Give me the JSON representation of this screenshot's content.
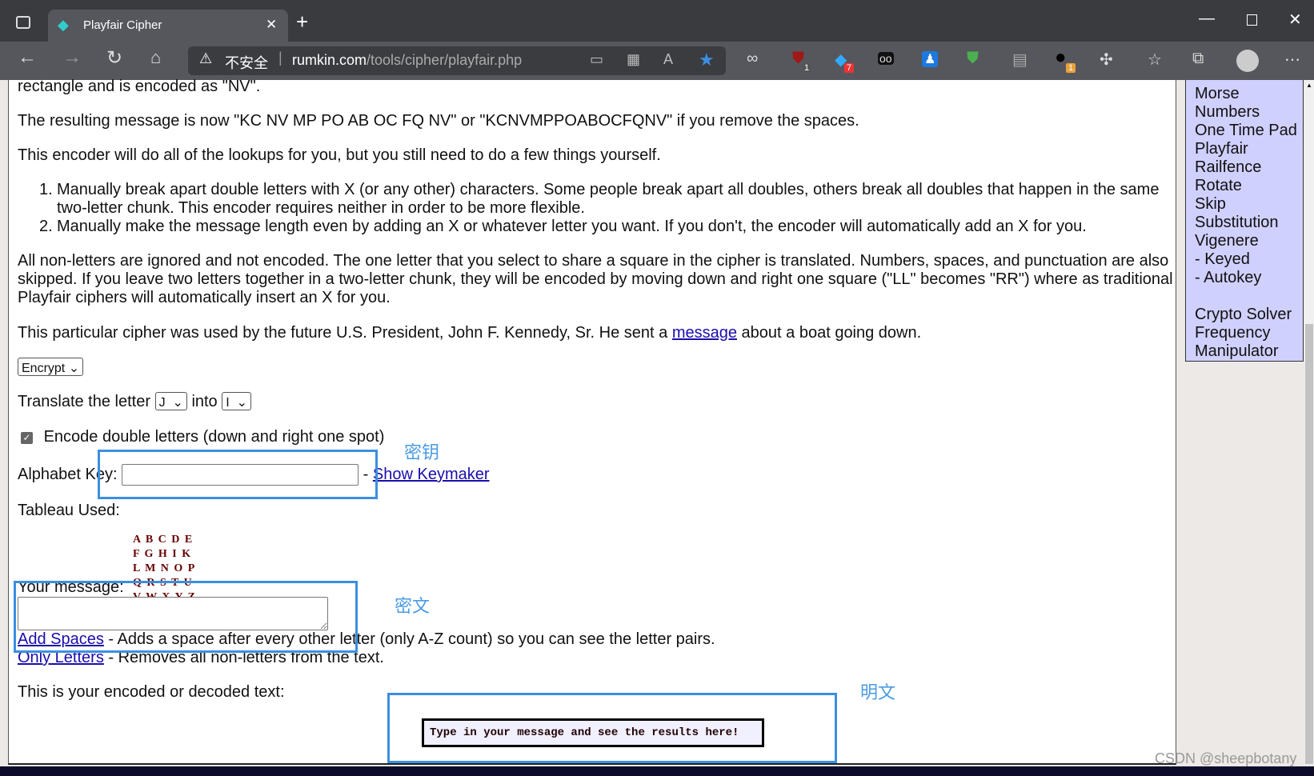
{
  "browser": {
    "tab_title": "Playfair Cipher",
    "security_label": "不安全",
    "url_domain": "rumkin.com",
    "url_path": "/tools/cipher/playfair.php",
    "extension_badges": {
      "ublock": "1",
      "ext2": "7",
      "ext_last": "1"
    }
  },
  "content": {
    "p0": "rectangle and is encoded as \"NV\".",
    "p1": "The resulting message is now \"KC NV MP PO AB OC FQ NV\" or \"KCNVMPPOABOCFQNV\" if you remove the spaces.",
    "p2": "This encoder will do all of the lookups for you, but you still need to do a few things yourself.",
    "list": [
      "Manually break apart double letters with X (or any other) characters. Some people break apart all doubles, others break all doubles that happen in the same two-letter chunk. This encoder requires neither in order to be more flexible.",
      "Manually make the message length even by adding an X or whatever letter you want. If you don't, the encoder will automatically add an X for you."
    ],
    "p3": "All non-letters are ignored and not encoded. The one letter that you select to share a square in the cipher is translated. Numbers, spaces, and punctuation are also skipped. If you leave two letters together in a two-letter chunk, they will be encoded by moving down and right one square (\"LL\" becomes \"RR\") where as traditional Playfair ciphers will automatically insert an X for you.",
    "p4_before": "This particular cipher was used by the future U.S. President, John F. Kennedy, Sr. He sent a",
    "p4_link": "message",
    "p4_after": "about a boat going down.",
    "mode_select": "Encrypt",
    "translate_label": "Translate the letter",
    "translate_from": "J",
    "into_label": "into",
    "translate_to": "I",
    "double_label": "Encode double letters (down and right one spot)",
    "double_checked": true,
    "alphabet_key_label": "Alphabet Key:",
    "alphabet_key_value": "",
    "dash": "-",
    "show_keymaker": "Show Keymaker",
    "tableau_label": "Tableau Used:",
    "tableau": [
      "A B C D E",
      "F G H I K",
      "L M N O P",
      "Q R S T U",
      "V W X Y Z"
    ],
    "your_message_label": "Your message:",
    "your_message_value": "",
    "add_spaces_link": "Add Spaces",
    "add_spaces_desc": "- Adds a space after every other letter (only A-Z count) so you can see the letter pairs.",
    "only_letters_link": "Only Letters",
    "only_letters_desc": "- Removes all non-letters from the text.",
    "result_label": "This is your encoded or decoded text:",
    "result_text": "Type in your message and see the results here!"
  },
  "annotations": {
    "key": "密钥",
    "ciphertext": "密文",
    "plaintext": "明文",
    "color": "#3b8fe0"
  },
  "sidebar": {
    "items": [
      "Morse",
      "Numbers",
      "One Time Pad",
      "Playfair",
      "Railfence",
      "Rotate",
      "Skip",
      "Substitution",
      "Vigenere",
      "- Keyed",
      "- Autokey",
      "",
      "Crypto Solver",
      "Frequency",
      "Manipulator"
    ]
  },
  "watermark": "CSDN @sheepbotany"
}
